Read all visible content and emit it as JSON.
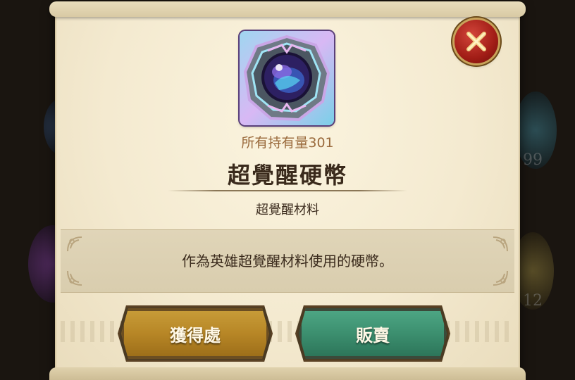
{
  "item": {
    "owned_text": "所有持有量301",
    "name": "超覺醒硬幣",
    "category": "超覺醒材料",
    "description": "作為英雄超覺醒材料使用的硬幣。",
    "icon": "awakening-coin-icon"
  },
  "buttons": {
    "obtain_label": "獲得處",
    "sell_label": "販賣",
    "close_icon": "close-icon"
  },
  "background": {
    "left_top_count": "",
    "right_mid_count": "99",
    "right_bottom_count": "12"
  },
  "colors": {
    "parchment": "#f4ead0",
    "obtain_button": "#b78626",
    "sell_button": "#3c8f6f",
    "close_button": "#a11d16",
    "title_text": "#3a2a1c",
    "owned_text": "#9a6a3c"
  }
}
